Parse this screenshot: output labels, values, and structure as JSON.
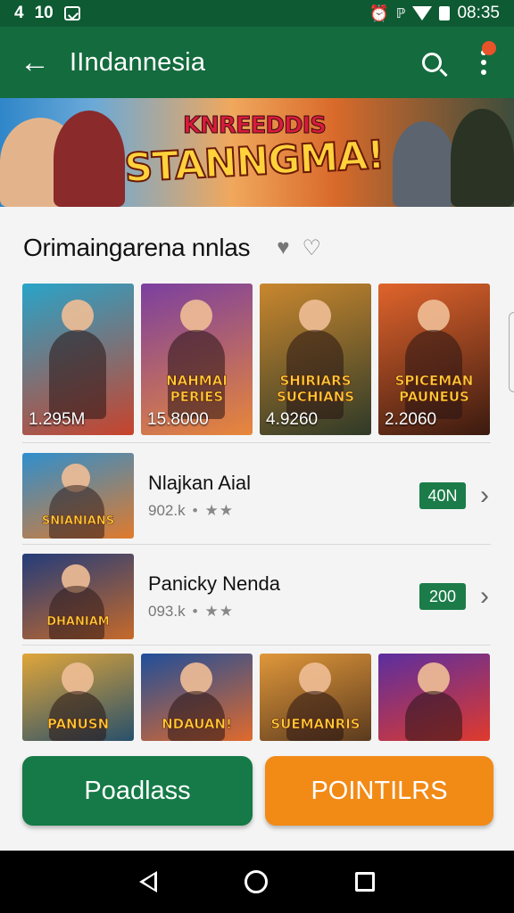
{
  "status_bar": {
    "left_items": [
      "4",
      "10"
    ],
    "time": "08:35"
  },
  "app_bar": {
    "back_icon": "arrow-left-icon",
    "title": "IIndannesia",
    "search_icon": "search-icon",
    "menu_icon": "more-vert-icon"
  },
  "banner": {
    "subtitle": "KNREEDDIS",
    "title": "STANNGMA!"
  },
  "section": {
    "title": "Orimaingarena nnlas",
    "heart_icon": "heart-icon"
  },
  "featured": [
    {
      "count": "1.295M",
      "caption": "",
      "colors": [
        "#29a4c9",
        "#c8432c"
      ]
    },
    {
      "count": "15.8000",
      "caption": "NAHMAI PERIES",
      "colors": [
        "#7b3fa0",
        "#e8873a"
      ]
    },
    {
      "count": "4.9260",
      "caption": "SHIRIARS SUCHIANS",
      "colors": [
        "#c9872e",
        "#2f3a28"
      ]
    },
    {
      "count": "2.2060",
      "caption": "SPICEMAN PAUNEUS",
      "colors": [
        "#e0642c",
        "#3a1a10"
      ]
    }
  ],
  "list": [
    {
      "title": "Nlajkan Aial",
      "downloads": "902.k",
      "stars": "★★",
      "price": "40N",
      "caption": "SNIANIANS",
      "colors": [
        "#2f8fce",
        "#e07a2c"
      ]
    },
    {
      "title": "Panicky Nenda",
      "downloads": "093.k",
      "stars": "★★",
      "price": "200",
      "caption": "DHANIAM",
      "colors": [
        "#233c7a",
        "#c66a2a"
      ]
    }
  ],
  "bottom_row": [
    {
      "caption": "PANUSN",
      "colors": [
        "#e0a63a",
        "#28506b"
      ]
    },
    {
      "caption": "NDAUAN!",
      "colors": [
        "#1f4e9a",
        "#e06a2c"
      ]
    },
    {
      "caption": "SUEMANRIS",
      "colors": [
        "#e0973a",
        "#5a3a1e"
      ]
    },
    {
      "caption": "",
      "colors": [
        "#5b2ea0",
        "#e03a2c"
      ]
    }
  ],
  "buttons": {
    "primary": "Poadlass",
    "accent": "POINTILRS"
  },
  "colors": {
    "primary": "#146b3e",
    "accent": "#f28a16"
  }
}
